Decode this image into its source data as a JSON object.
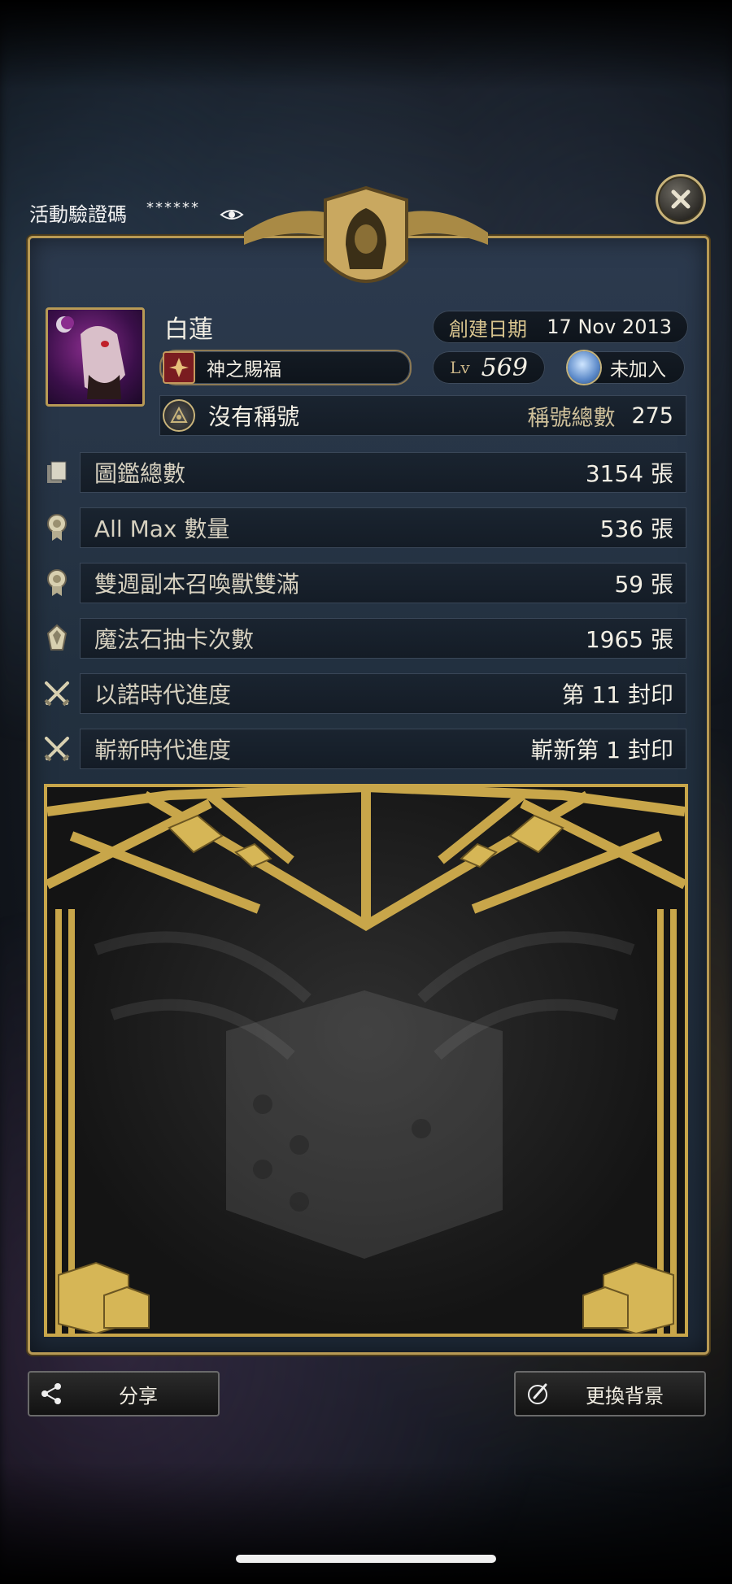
{
  "verify": {
    "label": "活動驗證碼",
    "masked": "******"
  },
  "profile": {
    "name": "白蓮",
    "created_label": "創建日期",
    "created_date": "17 Nov 2013",
    "blessing": "神之賜福",
    "level_label": "Lv",
    "level": "569",
    "guild_status": "未加入",
    "title": "沒有稱號",
    "title_count_label": "稱號總數",
    "title_count": "275"
  },
  "stats": [
    {
      "label": "圖鑑總數",
      "value": "3154 張",
      "icon": "card-stack-icon"
    },
    {
      "label": "All Max 數量",
      "value": "536 張",
      "icon": "medal-icon"
    },
    {
      "label": "雙週副本召喚獸雙滿",
      "value": "59 張",
      "icon": "medal-icon"
    },
    {
      "label": "魔法石抽卡次數",
      "value": "1965 張",
      "icon": "magic-stone-icon"
    },
    {
      "label": "以諾時代進度",
      "value": "第 11 封印",
      "icon": "crossed-swords-icon"
    },
    {
      "label": "嶄新時代進度",
      "value": "嶄新第 1 封印",
      "icon": "crossed-swords-icon"
    }
  ],
  "buttons": {
    "share": "分享",
    "change_bg": "更換背景"
  },
  "colors": {
    "gold": "#c8a64a",
    "panel": "#22303f"
  }
}
